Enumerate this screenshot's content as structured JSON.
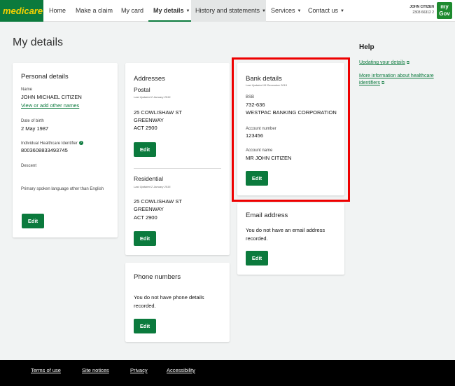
{
  "nav": {
    "logo": "medicare",
    "home": "Home",
    "make_claim": "Make a claim",
    "my_card": "My card",
    "my_details": "My details",
    "history": "History and statements",
    "services": "Services",
    "contact": "Contact us",
    "user_name": "JOHN CITIZEN",
    "user_number": "2303 66312 2",
    "mygov_line1": "my",
    "mygov_line2": "Gov"
  },
  "page": {
    "title": "My details"
  },
  "personal": {
    "title": "Personal details",
    "name_label": "Name",
    "name_value": "JOHN MICHAEL CITIZEN",
    "other_names_link": "View or add other names",
    "dob_label": "Date of birth",
    "dob_value": "2 May 1987",
    "ihi_label": "Individual Healthcare Identifier",
    "ihi_value": "8003608833493745",
    "descent_label": "Descent",
    "language_label": "Primary spoken language other than English",
    "edit": "Edit"
  },
  "addresses": {
    "title": "Addresses",
    "postal_title": "Postal",
    "postal_updated": "Last Updated 2 January 2016",
    "postal_line1": "25 COWLISHAW ST",
    "postal_line2": "GREENWAY",
    "postal_line3": "ACT 2900",
    "postal_edit": "Edit",
    "res_title": "Residential",
    "res_updated": "Last Updated 2 January 2016",
    "res_line1": "25 COWLISHAW ST",
    "res_line2": "GREENWAY",
    "res_line3": "ACT 2900",
    "res_edit": "Edit"
  },
  "phone": {
    "title": "Phone numbers",
    "message": "You do not have phone details recorded.",
    "edit": "Edit"
  },
  "bank": {
    "title": "Bank details",
    "updated": "Last Updated 16 December 2016",
    "bsb_label": "BSB",
    "bsb_value": "732-636",
    "bank_name": "WESTPAC BANKING CORPORATION",
    "acct_num_label": "Account number",
    "acct_num_value": "123456",
    "acct_name_label": "Account name",
    "acct_name_value": "MR JOHN CITIZEN",
    "edit": "Edit"
  },
  "email": {
    "title": "Email address",
    "message": "You do not have an email address recorded.",
    "edit": "Edit"
  },
  "help": {
    "title": "Help",
    "link1": "Updating your details",
    "link2": "More information about healthcare identifiers"
  },
  "footer": {
    "terms": "Terms of use",
    "site_notices": "Site notices",
    "privacy": "Privacy",
    "accessibility": "Accessibility"
  },
  "colors": {
    "brand_green": "#0b7a3d",
    "highlight_red": "#e00000",
    "logo_yellow": "#f4d000"
  }
}
